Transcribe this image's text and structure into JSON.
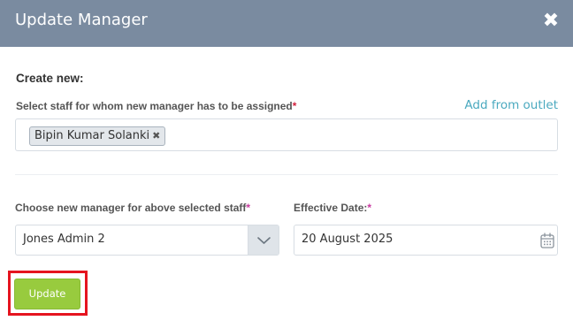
{
  "modal": {
    "title": "Update Manager",
    "close_glyph": "✖"
  },
  "form": {
    "section_title": "Create new:",
    "staff_label": "Select staff for whom new manager has to be assigned",
    "required_mark": "*",
    "add_from_outlet": "Add from outlet",
    "selected_staff": [
      {
        "name": "Bipin Kumar Solanki",
        "remove_glyph": "✖"
      }
    ],
    "manager_label": "Choose new manager for above selected staff",
    "manager_value": "Jones Admin 2",
    "effective_date_label": "Effective Date:",
    "effective_date_value": "20 August 2025",
    "update_button": "Update"
  },
  "colors": {
    "header_bg": "#7a8ba0",
    "link": "#4aa9bf",
    "button_bg": "#98cb3e",
    "highlight": "#e5141f",
    "required": "#d21f3c"
  },
  "icons": {
    "close": "close-icon",
    "tag_remove": "remove-tag-icon",
    "dropdown": "chevron-down-icon",
    "calendar": "calendar-icon"
  }
}
